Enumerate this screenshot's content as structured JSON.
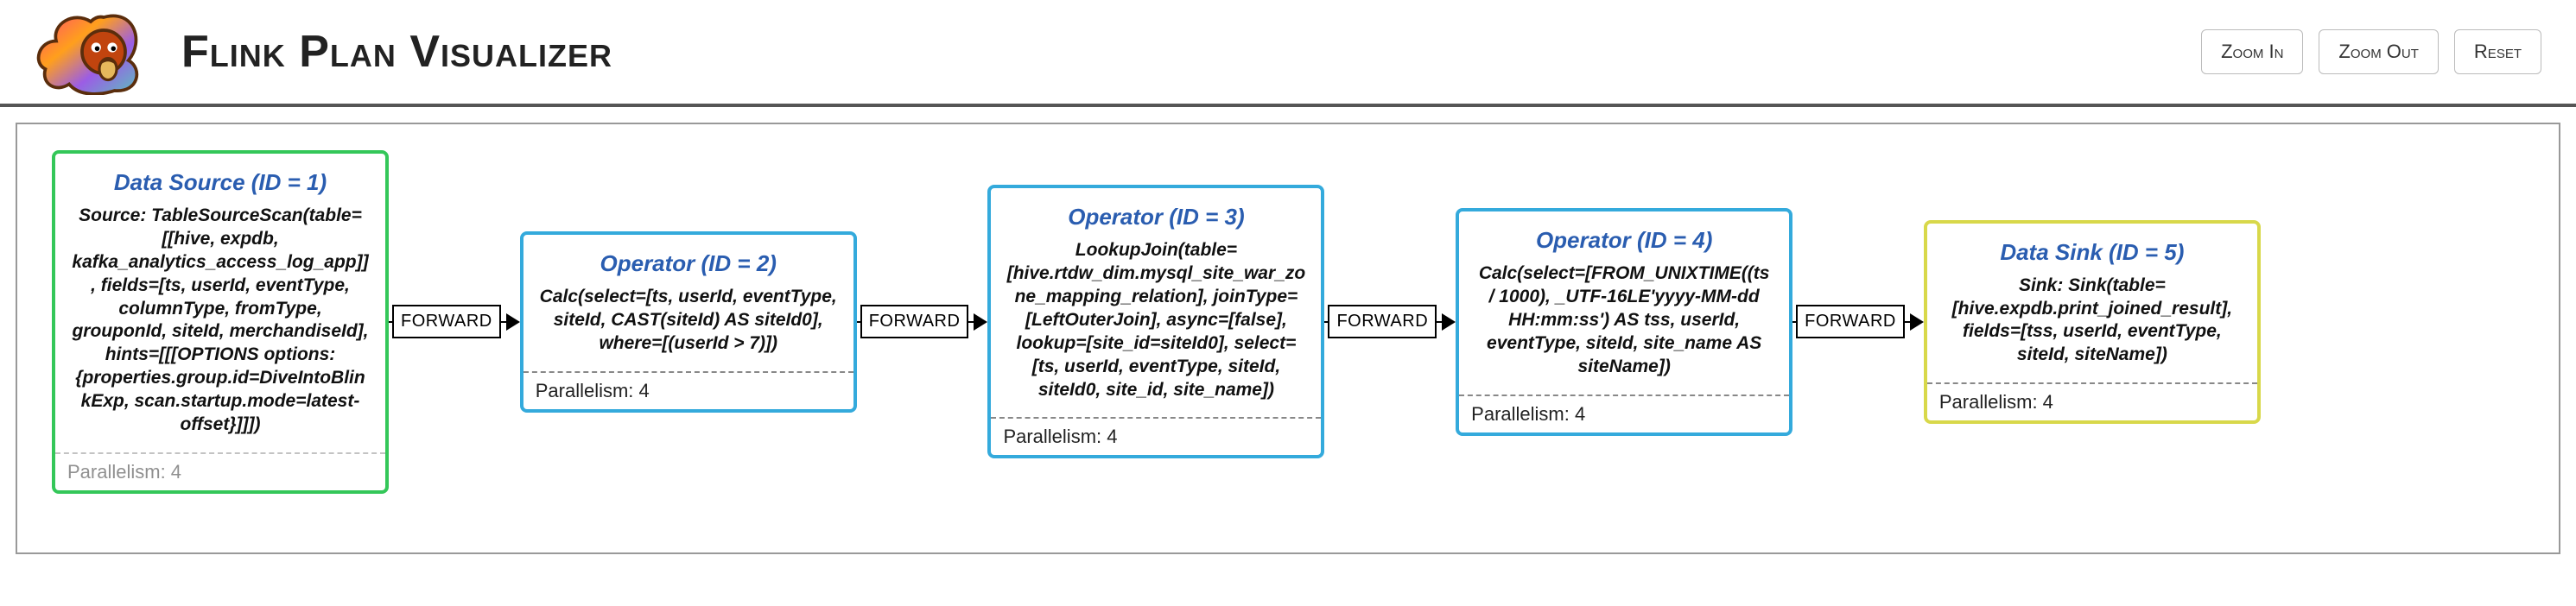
{
  "header": {
    "title": "Flink Plan Visualizer",
    "buttons": {
      "zoom_in": "Zoom In",
      "zoom_out": "Zoom Out",
      "reset": "Reset"
    }
  },
  "edge_label": "FORWARD",
  "parallelism_prefix": "Parallelism: ",
  "nodes": [
    {
      "id": 1,
      "color": "green",
      "title": "Data Source (ID = 1)",
      "body": "Source: TableSourceScan(table=[[hive, expdb, kafka_analytics_access_log_app]], fields=[ts, userId, eventType, columnType, fromType, grouponId, siteId, merchandiseId], hints=[[[OPTIONS options:{properties.group.id=DiveIntoBlinkExp, scan.startup.mode=latest-offset}]]])",
      "parallelism": 4
    },
    {
      "id": 2,
      "color": "blue",
      "title": "Operator (ID = 2)",
      "body": "Calc(select=[ts, userId, eventType, siteId, CAST(siteId) AS siteId0], where=[(userId > 7)])",
      "parallelism": 4
    },
    {
      "id": 3,
      "color": "blue",
      "title": "Operator (ID = 3)",
      "body": "LookupJoin(table=[hive.rtdw_dim.mysql_site_war_zone_mapping_relation], joinType=[LeftOuterJoin], async=[false], lookup=[site_id=siteId0], select=[ts, userId, eventType, siteId, siteId0, site_id, site_name])",
      "parallelism": 4
    },
    {
      "id": 4,
      "color": "blue",
      "title": "Operator (ID = 4)",
      "body": "Calc(select=[FROM_UNIXTIME((ts / 1000), _UTF-16LE'yyyy-MM-dd HH:mm:ss') AS tss, userId, eventType, siteId, site_name AS siteName])",
      "parallelism": 4
    },
    {
      "id": 5,
      "color": "yellow",
      "title": "Data Sink (ID = 5)",
      "body": "Sink: Sink(table=[hive.expdb.print_joined_result], fields=[tss, userId, eventType, siteId, siteName])",
      "parallelism": 4
    }
  ]
}
